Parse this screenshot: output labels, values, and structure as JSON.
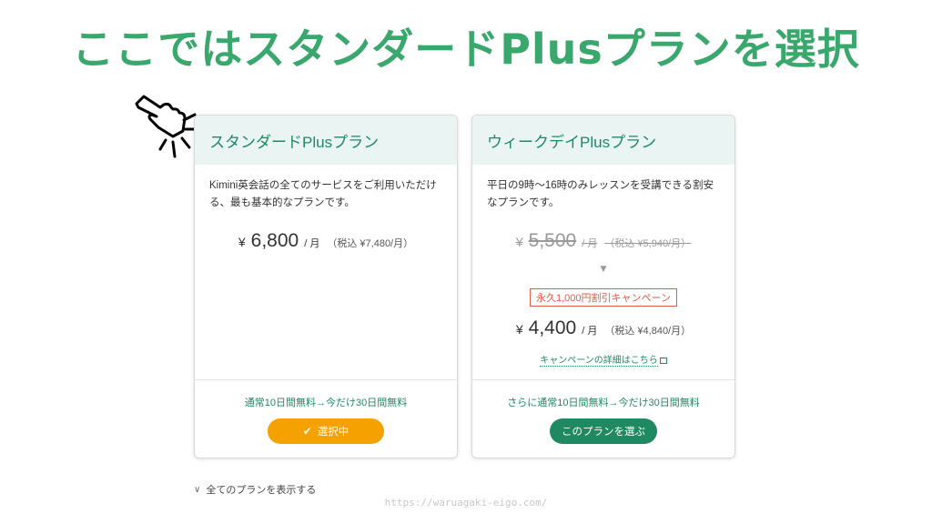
{
  "headline": "ここではスタンダードPlusプランを選択",
  "watermark": "https://waruagaki-eigo.com/",
  "plans": [
    {
      "name": "スタンダードPlusプラン",
      "description": "Kimini英会話の全てのサービスをご利用いただける、最も基本的なプランです。",
      "price": {
        "yen": "¥",
        "amount": "6,800",
        "per": "/ 月",
        "tax": "（税込 ¥7,480/月）"
      },
      "trial": "通常10日間無料→今だけ30日間無料",
      "button": {
        "label": "選択中",
        "icon": "check-icon",
        "color": "#f5a100"
      }
    },
    {
      "name": "ウィークデイPlusプラン",
      "description": "平日の9時〜16時のみレッスンを受講できる割安なプランです。",
      "original_price": {
        "yen": "¥",
        "amount": "5,500",
        "per": "/ 月",
        "tax": "（税込 ¥5,940/月）"
      },
      "arrow": "▼",
      "campaign_badge": "永久1,000円割引キャンペーン",
      "price": {
        "yen": "¥",
        "amount": "4,400",
        "per": "/ 月",
        "tax": "（税込 ¥4,840/月）"
      },
      "campaign_link": "キャンペーンの詳細はこちら",
      "trial": "さらに通常10日間無料→今だけ30日間無料",
      "button": {
        "label": "このプランを選ぶ",
        "color": "#1f8a61"
      }
    }
  ],
  "show_all_plans": "全てのプランを表示する",
  "colors": {
    "accent_green": "#3aa76d",
    "brand_green": "#1f8a61",
    "orange": "#f5a100",
    "campaign_red": "#e05a47"
  }
}
